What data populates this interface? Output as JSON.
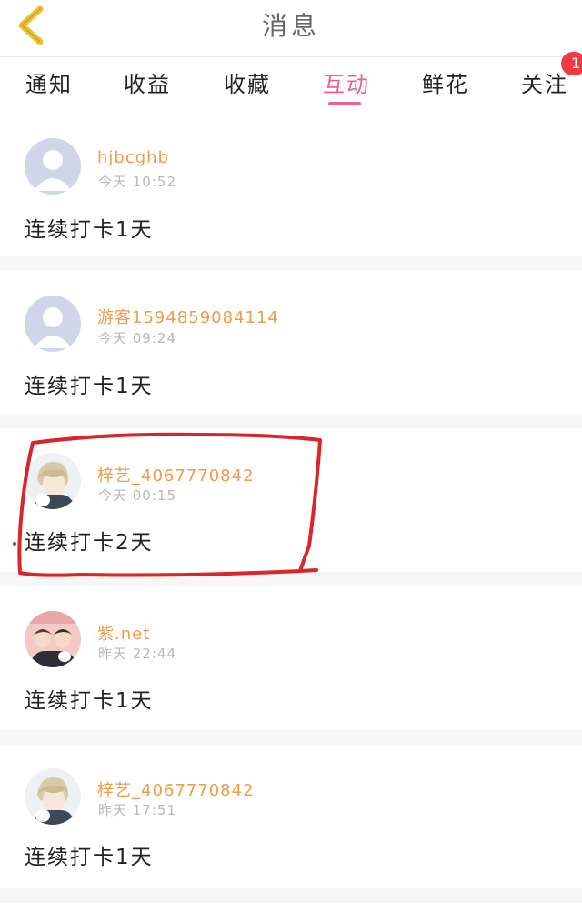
{
  "header": {
    "title": "消息",
    "back_icon": "chevron-left-icon",
    "back_color": "#f2c12e"
  },
  "tabs": [
    {
      "label": "通知",
      "active": false
    },
    {
      "label": "收益",
      "active": false
    },
    {
      "label": "收藏",
      "active": false
    },
    {
      "label": "互动",
      "active": true
    },
    {
      "label": "鲜花",
      "active": false
    },
    {
      "label": "关注",
      "active": false
    }
  ],
  "tab_badge": "1",
  "colors": {
    "accent": "#ee5f93",
    "username": "#f09a4a",
    "badge": "#ef3a46",
    "annotation": "#d9262c"
  },
  "messages": [
    {
      "username": "hjbcghb",
      "time": "今天 10:52",
      "text": "连续打卡1天",
      "avatar": "default-avatar"
    },
    {
      "username": "游客1594859084114",
      "time": "今天 09:24",
      "text": "连续打卡1天",
      "avatar": "default-avatar"
    },
    {
      "username": "梓艺_4067770842",
      "time": "今天 00:15",
      "text": "连续打卡2天",
      "avatar": "anime-boy-avatar",
      "highlighted": true
    },
    {
      "username": "紫.net",
      "time": "昨天 22:44",
      "text": "连续打卡1天",
      "avatar": "photo-couple-avatar"
    },
    {
      "username": "梓艺_4067770842",
      "time": "昨天 17:51",
      "text": "连续打卡1天",
      "avatar": "anime-boy-avatar"
    }
  ]
}
